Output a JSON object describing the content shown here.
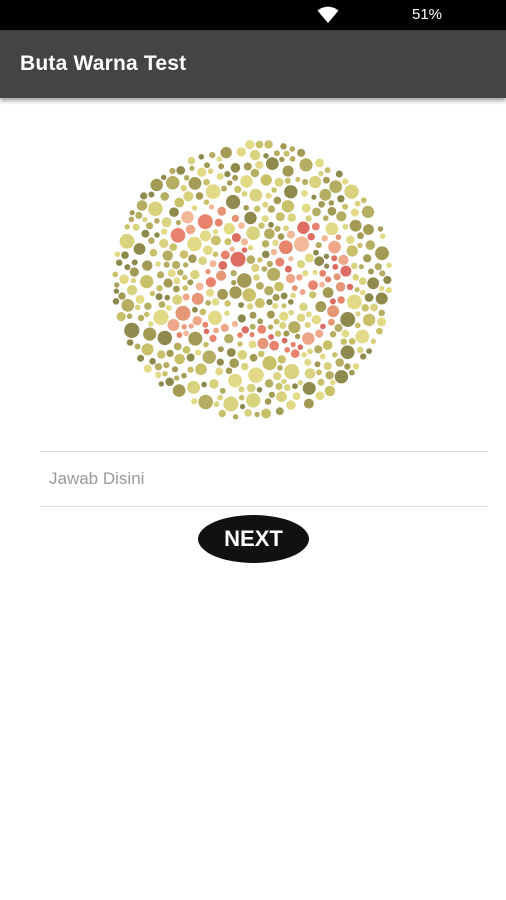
{
  "status_bar": {
    "wifi_icon": "wifi-icon",
    "battery_percent": "51%"
  },
  "app_bar": {
    "title": "Buta Warna Test",
    "background_color": "#444444"
  },
  "test": {
    "plate_image": "ishihara-color-blind-plate",
    "answer_placeholder": "Jawab Disini",
    "answer_value": "",
    "next_label": "NEXT"
  },
  "colors": {
    "background_palette": [
      "#c9c06a",
      "#a39b55",
      "#d9d27e",
      "#8e8a4d",
      "#e2da86",
      "#b5ad62"
    ],
    "figure_palette": [
      "#e8836e",
      "#f0a688",
      "#dd6d62",
      "#f4b797",
      "#e59676"
    ]
  }
}
